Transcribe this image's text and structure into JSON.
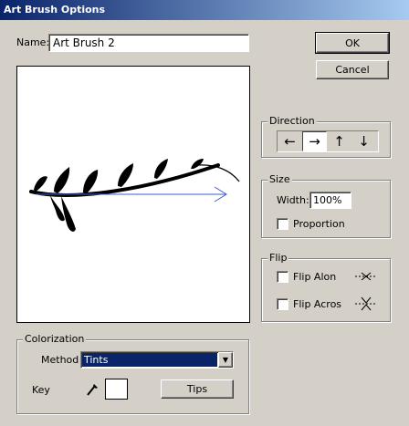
{
  "window": {
    "title": "Art Brush Options"
  },
  "name_field": {
    "label": "Name:",
    "value": "Art Brush 2"
  },
  "buttons": {
    "ok": "OK",
    "cancel": "Cancel",
    "tips": "Tips"
  },
  "direction": {
    "legend": "Direction",
    "options": [
      {
        "glyph": "←",
        "icon": "arrow-left-icon",
        "selected": false
      },
      {
        "glyph": "→",
        "icon": "arrow-right-icon",
        "selected": true
      },
      {
        "glyph": "↑",
        "icon": "arrow-up-icon",
        "selected": false
      },
      {
        "glyph": "↓",
        "icon": "arrow-down-icon",
        "selected": false
      }
    ]
  },
  "size": {
    "legend": "Size",
    "width_label": "Width:",
    "width_value": "100%",
    "proportion_label": "Proportion",
    "proportion_checked": false
  },
  "flip": {
    "legend": "Flip",
    "flip_along_label": "Flip Alon",
    "flip_along_checked": false,
    "flip_across_label": "Flip Acros",
    "flip_across_checked": false
  },
  "colorization": {
    "legend": "Colorization",
    "method_label": "Method",
    "method_value": "Tints",
    "key_label": "Key",
    "key_color": "#ffffff",
    "eyedropper_icon": "eyedropper-icon"
  },
  "colors": {
    "titlebar_start": "#0a246a",
    "dialog_bg": "#d4d0c8",
    "select_highlight": "#0a246a",
    "direction_arrow": "#3b5fc9"
  }
}
